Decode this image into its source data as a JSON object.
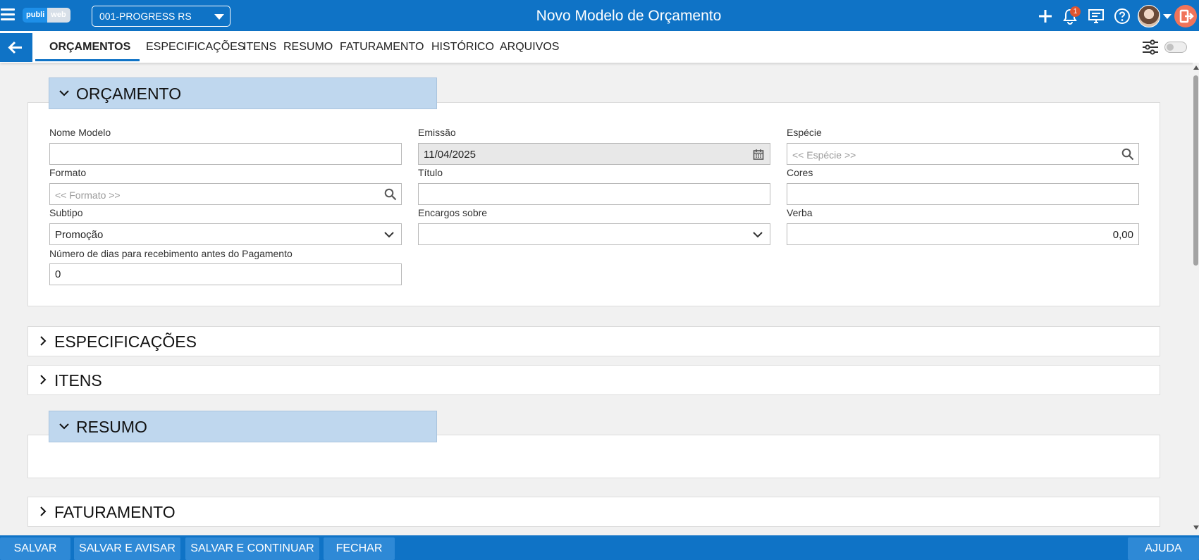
{
  "header": {
    "logo": {
      "part1": "publi",
      "part2": "web"
    },
    "unit_selector": "001-PROGRESS RS",
    "title": "Novo Modelo de Orçamento",
    "notification_count": "1",
    "icons": [
      "menu-icon",
      "plus-icon",
      "bell-icon",
      "monitor-icon",
      "help-icon",
      "avatar",
      "chevron-down-icon",
      "logout-icon"
    ]
  },
  "nav": {
    "tabs": [
      {
        "label": "ORÇAMENTOS",
        "active": true
      },
      {
        "label": "ESPECIFICAÇÕES"
      },
      {
        "label": "ITENS"
      },
      {
        "label": "RESUMO"
      },
      {
        "label": "FATURAMENTO"
      },
      {
        "label": "HISTÓRICO"
      },
      {
        "label": "ARQUIVOS"
      }
    ]
  },
  "orcamento": {
    "title": "ORÇAMENTO",
    "fields": {
      "nome_modelo": {
        "label": "Nome Modelo",
        "value": ""
      },
      "emissao": {
        "label": "Emissão",
        "value": "11/04/2025"
      },
      "especie": {
        "label": "Espécie",
        "placeholder": "<< Espécie >>"
      },
      "formato": {
        "label": "Formato",
        "placeholder": "<< Formato >>"
      },
      "titulo": {
        "label": "Título",
        "value": ""
      },
      "cores": {
        "label": "Cores",
        "value": ""
      },
      "subtipo": {
        "label": "Subtipo",
        "value": "Promoção"
      },
      "encargos": {
        "label": "Encargos sobre",
        "value": ""
      },
      "verba": {
        "label": "Verba",
        "value": "0,00"
      },
      "dias": {
        "label": "Número de dias para recebimento antes do Pagamento",
        "value": "0"
      }
    }
  },
  "sections": {
    "especificacoes": "ESPECIFICAÇÕES",
    "itens": "ITENS",
    "resumo": "RESUMO",
    "faturamento": "FATURAMENTO"
  },
  "footer": {
    "salvar": "SALVAR",
    "salvar_avisar": "SALVAR E AVISAR",
    "salvar_continuar": "SALVAR E CONTINUAR",
    "fechar": "FECHAR",
    "ajuda": "AJUDA"
  },
  "colors": {
    "primary": "#0f73c6",
    "section_header": "#bfd7ee",
    "button": "#2e89d6",
    "badge": "#e0542e",
    "logout": "#f0745a"
  }
}
